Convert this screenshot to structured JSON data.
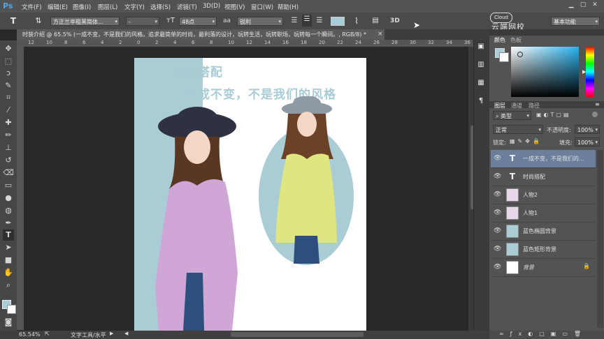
{
  "app": {
    "logo": "Ps"
  },
  "menu": [
    {
      "label": "文件(F)"
    },
    {
      "label": "编辑(E)"
    },
    {
      "label": "图像(I)"
    },
    {
      "label": "图层(L)"
    },
    {
      "label": "文字(Y)"
    },
    {
      "label": "选择(S)"
    },
    {
      "label": "滤镜(T)"
    },
    {
      "label": "3D(D)"
    },
    {
      "label": "视图(V)"
    },
    {
      "label": "窗口(W)"
    },
    {
      "label": "帮助(H)"
    }
  ],
  "options": {
    "font_family": "方正兰亭粗黑简体...",
    "font_style": "-",
    "font_size": "48点",
    "antialias_label": "aa",
    "antialias": "锐利",
    "text_color": "#a8cdd8",
    "workspace": "基本功能",
    "threed_label": "3D"
  },
  "watermark": {
    "text": "云端网校",
    "badge": "Cloud"
  },
  "document": {
    "tab_title": "时装介绍 @ 65.5% (一成不变，不是我们的风格。追求最简单的时尚，最利落的设计，玩转生活，玩转职场，玩转每一个瞬间。, RGB/8) *",
    "canvas_title": "时尚搭配",
    "canvas_subtitle": "一成不变，不是我们的风格",
    "bg_color": "#a9ccd5",
    "coat_lilac": "#cfa6d6",
    "coat_yellow": "#dfe67f"
  },
  "rulers": {
    "top": [
      "12",
      "10",
      "8",
      "6",
      "4",
      "2",
      "0",
      "2",
      "4",
      "6",
      "8",
      "10",
      "12",
      "14",
      "16",
      "18",
      "20",
      "22",
      "24",
      "26",
      "28",
      "30",
      "32",
      "34",
      "36"
    ]
  },
  "status": {
    "zoom": "65.54%",
    "tool": "文字工具/水平"
  },
  "panels": {
    "color_tabs": [
      "颜色",
      "色板"
    ],
    "layer_tabs": [
      "图层",
      "通道",
      "路径"
    ],
    "filter_kind": "类型",
    "blend_mode": "正常",
    "opacity_label": "不透明度:",
    "opacity": "100%",
    "lock_label": "锁定:",
    "fill_label": "填充:",
    "fill": "100%"
  },
  "layers": [
    {
      "name": "一成不变，不是我们的...",
      "kind": "text",
      "selected": true
    },
    {
      "name": "时尚搭配",
      "kind": "text",
      "selected": false
    },
    {
      "name": "人物2",
      "kind": "image",
      "selected": false
    },
    {
      "name": "人物1",
      "kind": "image",
      "selected": false
    },
    {
      "name": "蓝色椭圆背景",
      "kind": "shape",
      "selected": false
    },
    {
      "name": "蓝色矩形背景",
      "kind": "shape",
      "selected": false
    },
    {
      "name": "背景",
      "kind": "background",
      "selected": false
    }
  ]
}
